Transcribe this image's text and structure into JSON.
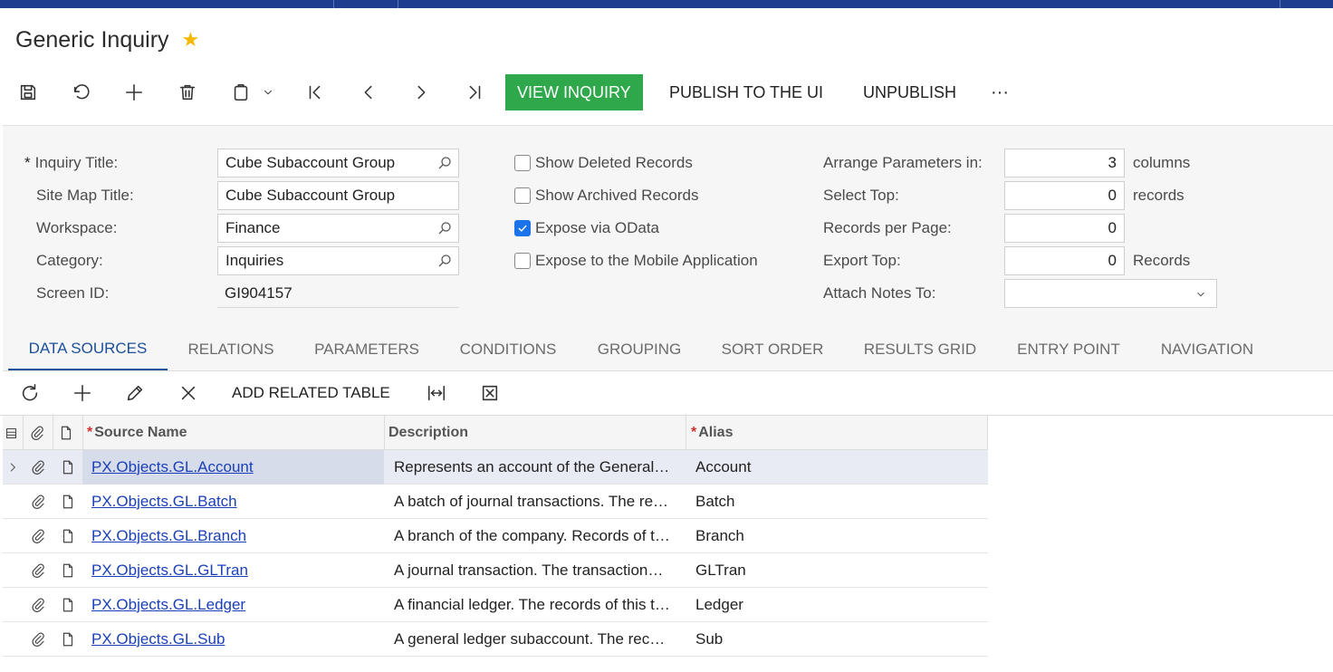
{
  "window": {
    "title": "Generic Inquiry"
  },
  "toolbar": {
    "view_inquiry": "VIEW INQUIRY",
    "publish": "PUBLISH TO THE UI",
    "unpublish": "UNPUBLISH",
    "more": "···"
  },
  "form": {
    "inquiry_title_label": "Inquiry Title:",
    "inquiry_title_value": "Cube Subaccount Group",
    "site_map_title_label": "Site Map Title:",
    "site_map_title_value": "Cube Subaccount Group",
    "workspace_label": "Workspace:",
    "workspace_value": "Finance",
    "category_label": "Category:",
    "category_value": "Inquiries",
    "screen_id_label": "Screen ID:",
    "screen_id_value": "GI904157",
    "show_deleted": "Show Deleted Records",
    "show_archived": "Show Archived Records",
    "expose_odata": "Expose via OData",
    "expose_mobile": "Expose to the Mobile Application",
    "arrange_label": "Arrange Parameters in:",
    "arrange_value": "3",
    "arrange_suffix": "columns",
    "select_top_label": "Select Top:",
    "select_top_value": "0",
    "select_top_suffix": "records",
    "records_per_page_label": "Records per Page:",
    "records_per_page_value": "0",
    "export_top_label": "Export Top:",
    "export_top_value": "0",
    "export_top_suffix": "Records",
    "attach_notes_label": "Attach Notes To:",
    "attach_notes_value": ""
  },
  "tabs": [
    "DATA SOURCES",
    "RELATIONS",
    "PARAMETERS",
    "CONDITIONS",
    "GROUPING",
    "SORT ORDER",
    "RESULTS GRID",
    "ENTRY POINT",
    "NAVIGATION"
  ],
  "grid_toolbar": {
    "add_related": "ADD RELATED TABLE"
  },
  "grid": {
    "headers": {
      "source": "Source Name",
      "description": "Description",
      "alias": "Alias"
    },
    "rows": [
      {
        "source": "PX.Objects.GL.Account",
        "description": "Represents an account of the General…",
        "alias": "Account"
      },
      {
        "source": "PX.Objects.GL.Batch",
        "description": "A batch of journal transactions. The re…",
        "alias": "Batch"
      },
      {
        "source": "PX.Objects.GL.Branch",
        "description": "A branch of the company. Records of t…",
        "alias": "Branch"
      },
      {
        "source": "PX.Objects.GL.GLTran",
        "description": "A journal transaction. The transaction…",
        "alias": "GLTran"
      },
      {
        "source": "PX.Objects.GL.Ledger",
        "description": "A financial ledger. The records of this t…",
        "alias": "Ledger"
      },
      {
        "source": "PX.Objects.GL.Sub",
        "description": "A general ledger subaccount. The rec…",
        "alias": "Sub"
      }
    ]
  }
}
